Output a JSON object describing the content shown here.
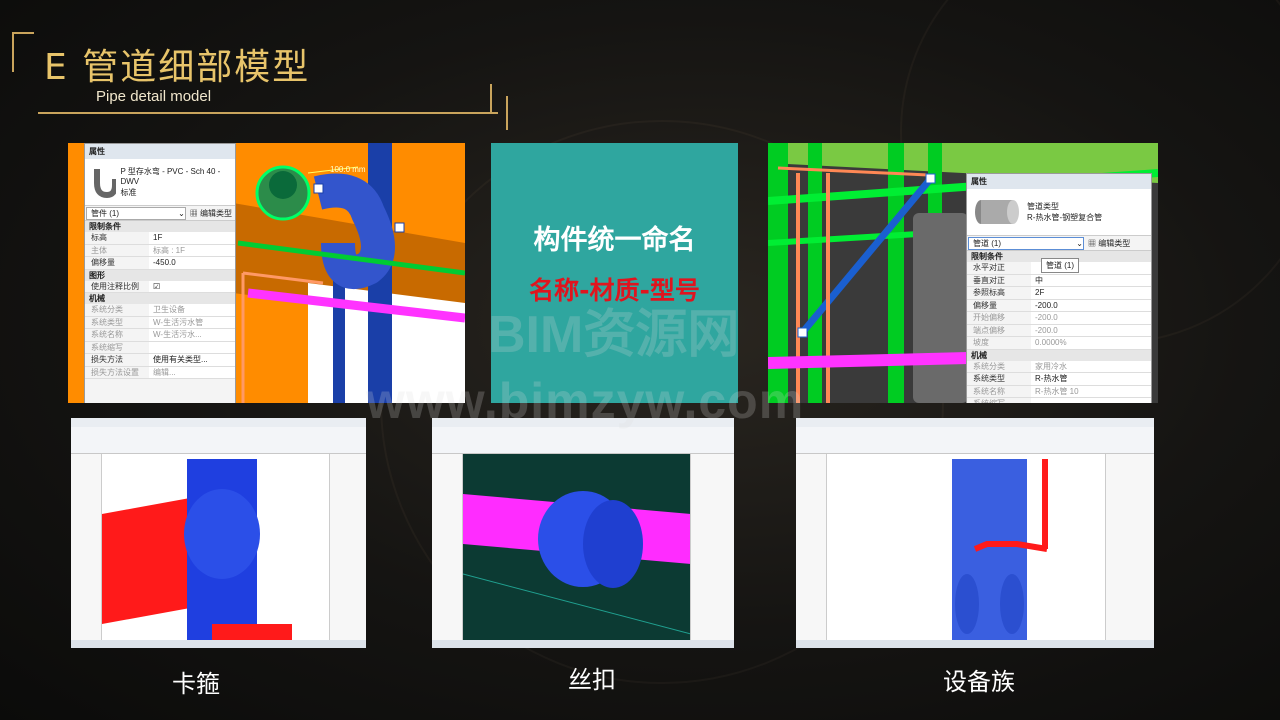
{
  "title": {
    "main": "E  管道细部模型",
    "sub": "Pipe detail model"
  },
  "panel1": {
    "header": "属性",
    "family_name": "P 型存水弯 - PVC - Sch 40 - DWV",
    "family_type": "标准",
    "selector": "管件 (1)",
    "edit_type": "编辑类型",
    "dimension_label": "100.0 mm",
    "rows": [
      {
        "section": "限制条件"
      },
      {
        "k": "标高",
        "v": "1F"
      },
      {
        "k": "主体",
        "v": "标高 : 1F",
        "dim": true
      },
      {
        "k": "偏移量",
        "v": "-450.0"
      },
      {
        "section": "图形"
      },
      {
        "k": "使用注释比例",
        "v": "☑"
      },
      {
        "section": "机械"
      },
      {
        "k": "系统分类",
        "v": "卫生设备",
        "dim": true
      },
      {
        "k": "系统类型",
        "v": "W-生活污水管",
        "dim": true
      },
      {
        "k": "系统名称",
        "v": "W-生活污水...",
        "dim": true
      },
      {
        "k": "系统缩写",
        "v": "",
        "dim": true
      },
      {
        "k": "损失方法",
        "v": "使用有关类型..."
      },
      {
        "k": "损失方法设置",
        "v": "编辑...",
        "dim": true
      }
    ]
  },
  "panel2": {
    "heading": "构件统一命名",
    "subheading": "名称-材质-型号"
  },
  "panel3": {
    "header": "属性",
    "family_name": "管道类型",
    "family_type": "R-热水管-钢塑复合管",
    "selector": "管道 (1)",
    "edit_type": "编辑类型",
    "tooltip": "管道 (1)",
    "rows": [
      {
        "section": "限制条件"
      },
      {
        "k": "水平对正",
        "v": ""
      },
      {
        "k": "垂直对正",
        "v": "中"
      },
      {
        "k": "参照标高",
        "v": "2F"
      },
      {
        "k": "偏移量",
        "v": "-200.0"
      },
      {
        "k": "开始偏移",
        "v": "-200.0",
        "dim": true
      },
      {
        "k": "端点偏移",
        "v": "-200.0",
        "dim": true
      },
      {
        "k": "坡度",
        "v": "0.0000%",
        "dim": true
      },
      {
        "section": "机械"
      },
      {
        "k": "系统分类",
        "v": "家用冷水",
        "dim": true
      },
      {
        "k": "系统类型",
        "v": "R-热水管"
      },
      {
        "k": "系统名称",
        "v": "R-热水管 10",
        "dim": true
      },
      {
        "k": "系统缩写",
        "v": "",
        "dim": true
      }
    ]
  },
  "captions": {
    "clamp": "卡箍",
    "thread": "丝扣",
    "equipment": "设备族"
  },
  "watermark": {
    "line1": "BIM资源网",
    "line2": "www.bimzyw.com"
  },
  "colors": {
    "accent_gold": "#e8c46a",
    "frame_gold": "#c9a45c",
    "teal_panel": "#2fa69f",
    "red_text": "#e0141e"
  }
}
